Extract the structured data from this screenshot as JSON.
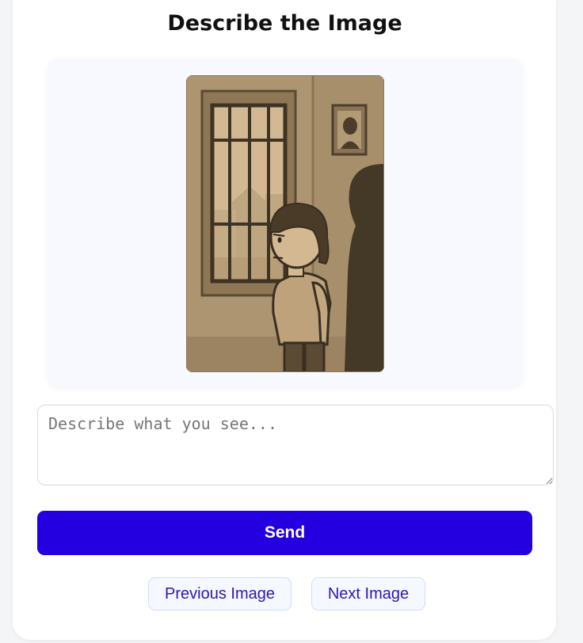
{
  "page": {
    "title": "Describe the Image"
  },
  "image": {
    "subject": "sepia illustration of a child standing near a barred window with a shadowy adult figure behind"
  },
  "description": {
    "placeholder": "Describe what you see...",
    "value": ""
  },
  "actions": {
    "send_label": "Send",
    "previous_label": "Previous Image",
    "next_label": "Next Image"
  },
  "colors": {
    "primary": "#2400e0",
    "secondary_text": "#2a17b8",
    "secondary_bg": "#f5f8ff",
    "panel_bg": "#f7f9ff"
  }
}
